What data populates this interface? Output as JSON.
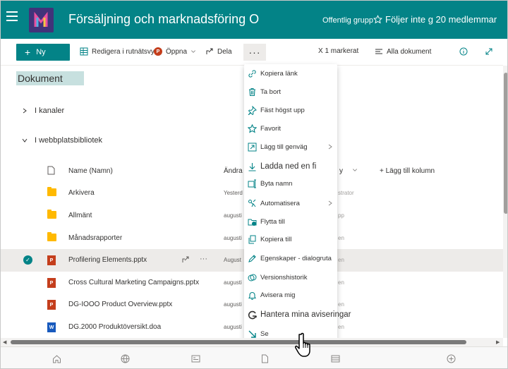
{
  "header": {
    "site_title": "Försäljning och marknadsföring O",
    "group_type": "Offentlig grupp",
    "follow_label": "Följer inte g 20 medlemmar",
    "logo_glyph": "M"
  },
  "toolbar": {
    "new_label": "Ny",
    "grid_edit_label": "Redigera i rutnätsvy",
    "open_label": "Öppna",
    "share_label": "Dela",
    "more_label": "···",
    "selected_label": "X 1 markerat",
    "view_label": "Alla dokument"
  },
  "library": {
    "title": "Dokument",
    "section_channels": "I kanaler",
    "section_sites": "I webbplatsbibliotek",
    "col_name": "Name (Namn)",
    "col_modified": "Ändra",
    "col_modified_by": "y",
    "col_add": "Lägg till kolumn",
    "rows": [
      {
        "name": "Arkivera",
        "modified": "Yesterd",
        "modified_by": "strator",
        "type": "folder"
      },
      {
        "name": "Allmänt",
        "modified": "augusti",
        "modified_by": "pp",
        "type": "folder"
      },
      {
        "name": "Månadsrapporter",
        "modified": "augusti",
        "modified_by": "en",
        "type": "folder"
      },
      {
        "name": "Profilering Elements.pptx",
        "modified": "August",
        "modified_by": "en",
        "type": "ppt",
        "selected": true
      },
      {
        "name": "Cross Cultural Marketing Campaigns.pptx",
        "modified": "augusti",
        "modified_by": "en",
        "type": "ppt"
      },
      {
        "name": "DG-IOOO Product Overview.pptx",
        "modified": "augusti",
        "modified_by": "en",
        "type": "ppt"
      },
      {
        "name": "DG.2000 Produktöversikt.doa",
        "modified": "augusti",
        "modified_by": "en",
        "type": "word"
      }
    ]
  },
  "file_badges": {
    "ppt": "P",
    "word": "W"
  },
  "context_menu": {
    "items": [
      {
        "label": "Kopiera länk",
        "icon": "link-icon"
      },
      {
        "label": "Ta bort",
        "icon": "trash-icon"
      },
      {
        "label": "Fäst högst upp",
        "icon": "pin-icon"
      },
      {
        "label": "Favorit",
        "icon": "star-icon"
      },
      {
        "label": "Lägg till genväg",
        "icon": "shortcut-icon",
        "submenu": true
      },
      {
        "label": "Ladda ned en fi",
        "icon": "download-icon"
      },
      {
        "label": "Byta namn",
        "icon": "rename-icon"
      },
      {
        "label": "Automatisera",
        "icon": "automate-icon",
        "submenu": true
      },
      {
        "label": "Flytta till",
        "icon": "move-icon"
      },
      {
        "label": "Kopiera till",
        "icon": "copy-icon"
      },
      {
        "label": "Egenskaper - dialogruta",
        "icon": "edit-icon"
      },
      {
        "label": "Versionshistorik",
        "icon": "history-icon"
      },
      {
        "label": "Avisera mig",
        "icon": "bell-icon"
      },
      {
        "label": "Hantera mina aviseringar",
        "icon": "alert-manage-icon"
      },
      {
        "label": "Se",
        "icon": "arrow-icon"
      }
    ]
  },
  "colors": {
    "accent": "#038387",
    "brand_logo": "#41337a"
  }
}
